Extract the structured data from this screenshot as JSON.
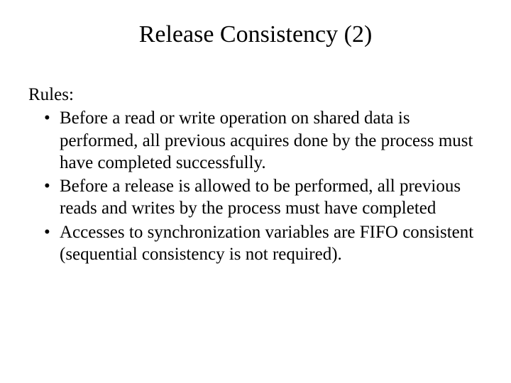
{
  "title": "Release Consistency (2)",
  "rules_label": "Rules:",
  "bullets": [
    "Before a read or write operation on shared data is performed, all previous acquires done by the process must have completed successfully.",
    "Before a release is allowed to be performed, all previous reads and writes by the process must have completed",
    "Accesses to synchronization variables are FIFO consistent (sequential consistency is not required)."
  ]
}
